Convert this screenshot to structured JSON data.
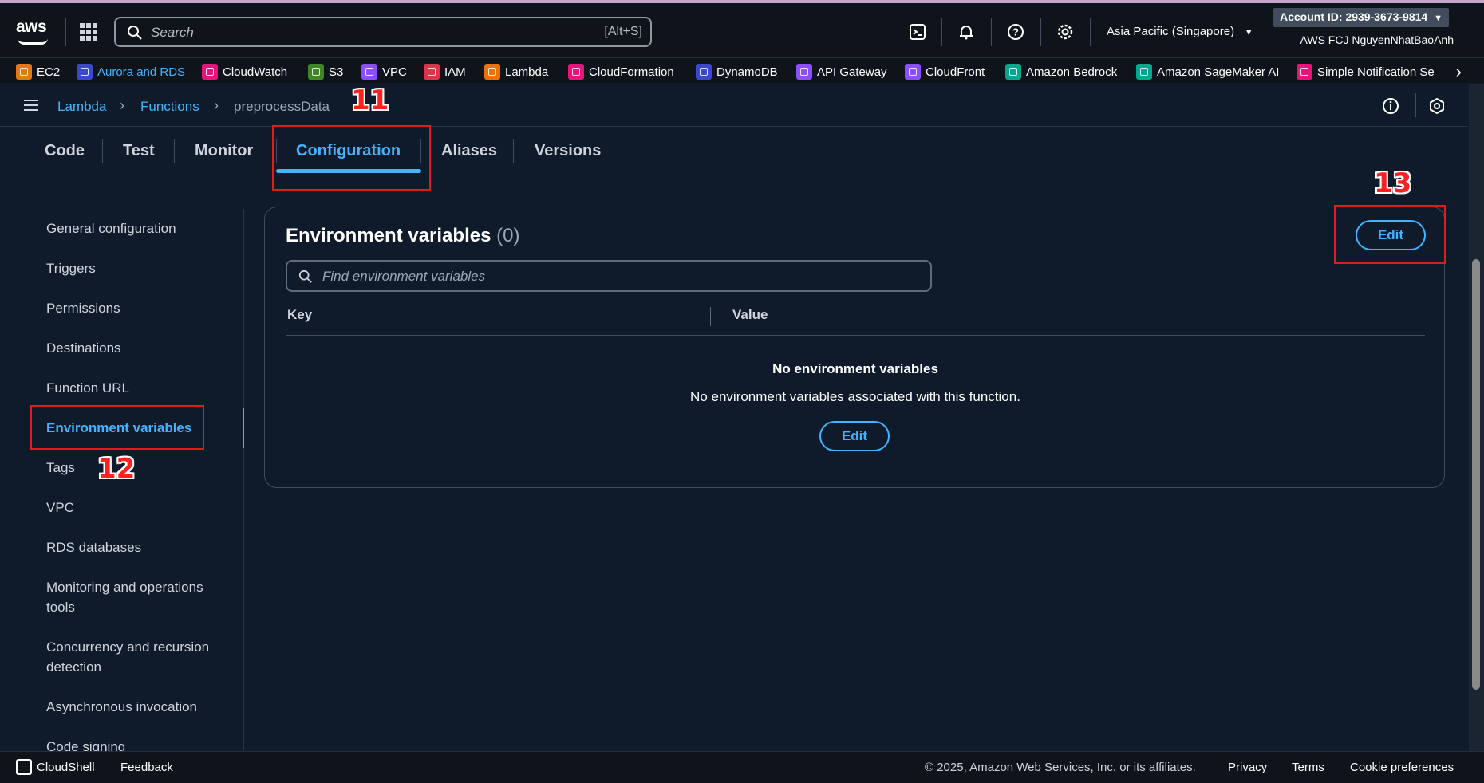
{
  "topnav": {
    "logo": "aws",
    "search_placeholder": "Search",
    "search_shortcut": "[Alt+S]",
    "region": "Asia Pacific (Singapore)",
    "account_id": "Account ID: 2939-3673-9814",
    "account_name": "AWS FCJ NguyenNhatBaoAnh"
  },
  "favorites": [
    {
      "label": "EC2",
      "color": "#e07b14"
    },
    {
      "label": "Aurora and RDS",
      "color": "#3b48cc"
    },
    {
      "label": "CloudWatch",
      "color": "#e7157b"
    },
    {
      "label": "S3",
      "color": "#3f8624"
    },
    {
      "label": "VPC",
      "color": "#8c4fff"
    },
    {
      "label": "IAM",
      "color": "#dd344c"
    },
    {
      "label": "Lambda",
      "color": "#ed7100"
    },
    {
      "label": "CloudFormation",
      "color": "#e7157b"
    },
    {
      "label": "DynamoDB",
      "color": "#3b48cc"
    },
    {
      "label": "API Gateway",
      "color": "#8c4fff"
    },
    {
      "label": "CloudFront",
      "color": "#8c4fff"
    },
    {
      "label": "Amazon Bedrock",
      "color": "#01a88d"
    },
    {
      "label": "Amazon SageMaker AI",
      "color": "#01a88d"
    },
    {
      "label": "Simple Notification Se",
      "color": "#e7157b"
    }
  ],
  "breadcrumb": {
    "items": [
      "Lambda",
      "Functions",
      "preprocessData"
    ]
  },
  "annotations": {
    "a11": "11",
    "a12": "12",
    "a13": "13"
  },
  "tabs": [
    "Code",
    "Test",
    "Monitor",
    "Configuration",
    "Aliases",
    "Versions"
  ],
  "sidenav": [
    "General configuration",
    "Triggers",
    "Permissions",
    "Destinations",
    "Function URL",
    "Environment variables",
    "Tags",
    "VPC",
    "RDS databases",
    "Monitoring and operations tools",
    "Concurrency and recursion detection",
    "Asynchronous invocation",
    "Code signing"
  ],
  "panel": {
    "title": "Environment variables",
    "count": "(0)",
    "edit_label": "Edit",
    "filter_placeholder": "Find environment variables",
    "col_key": "Key",
    "col_value": "Value",
    "empty_title": "No environment variables",
    "empty_desc": "No environment variables associated with this function.",
    "empty_edit_label": "Edit"
  },
  "footer": {
    "cloudshell": "CloudShell",
    "feedback": "Feedback",
    "copyright": "© 2025, Amazon Web Services, Inc. or its affiliates.",
    "privacy": "Privacy",
    "terms": "Terms",
    "cookies": "Cookie preferences"
  },
  "colors": {
    "accent": "#42b4ff",
    "background": "#0f1b2a",
    "annotation": "#e21b1b"
  }
}
